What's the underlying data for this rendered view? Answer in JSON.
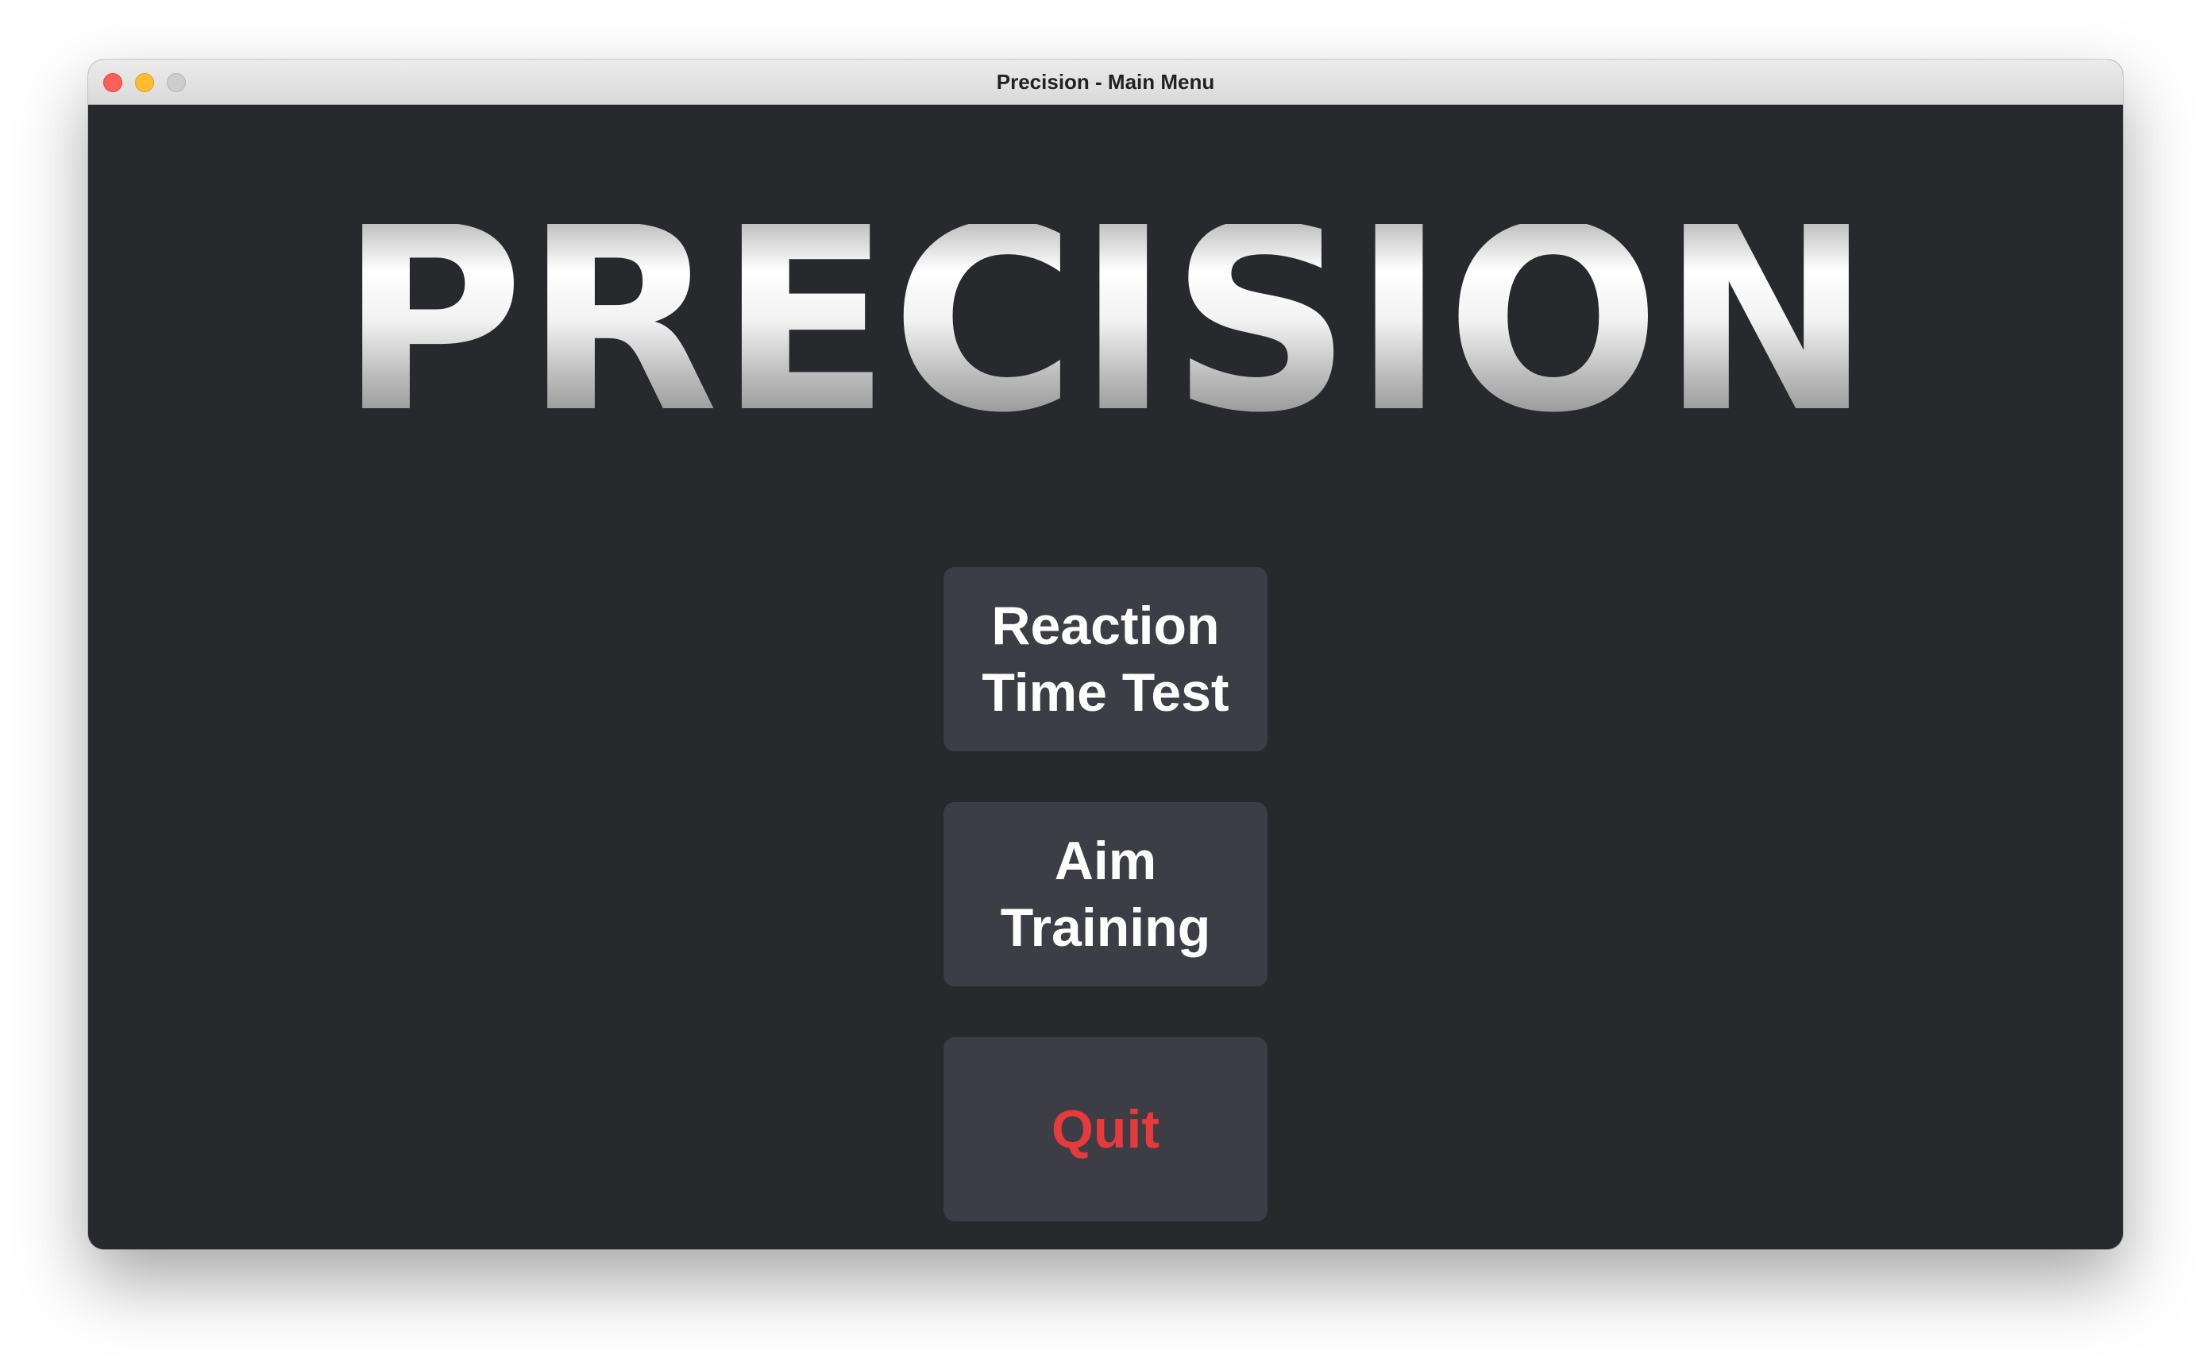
{
  "window": {
    "title": "Precision - Main Menu"
  },
  "logo": {
    "text": "PRECISION"
  },
  "menu": {
    "items": [
      {
        "label": "Reaction\nTime Test"
      },
      {
        "label": "Aim\nTraining"
      },
      {
        "label": "Quit",
        "color": "#e8393d"
      }
    ]
  },
  "colors": {
    "background": "#28292d",
    "button": "#3d3e45",
    "button_text": "#ffffff",
    "quit_text": "#e8393d"
  }
}
